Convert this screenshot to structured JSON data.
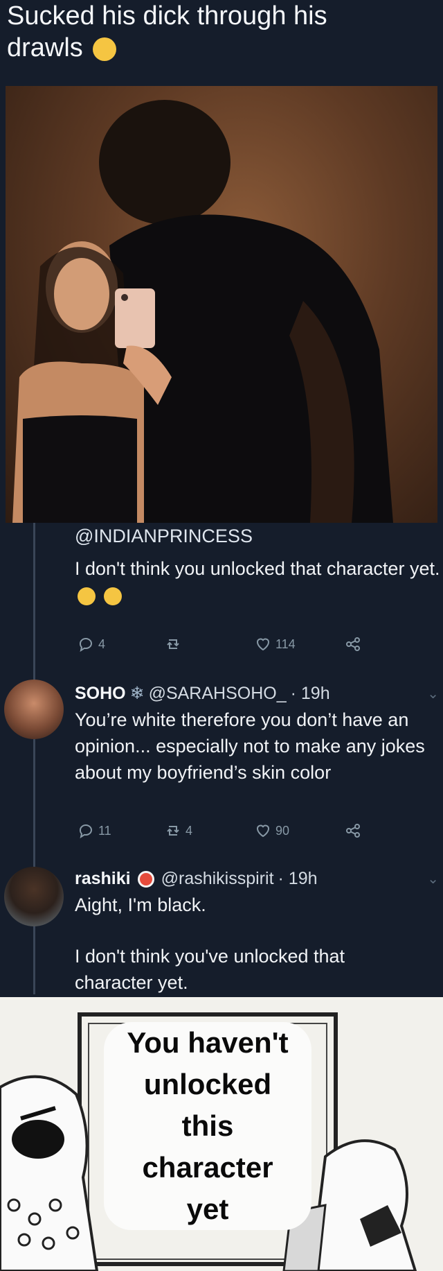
{
  "caption": "Sucked his dick through his drawls",
  "tweet1": {
    "handle": "@INDIANPRINCESS",
    "text": "I don't think you unlocked that character yet.",
    "replies": "4",
    "retweets": "",
    "likes": "114"
  },
  "tweet2": {
    "name": "SOHO",
    "handle": "@SARAHSOHO_",
    "time": "· 19h",
    "text": "You’re white therefore you don’t have an opinion... especially not to make any jokes about my boyfriend’s skin color",
    "replies": "11",
    "retweets": "4",
    "likes": "90"
  },
  "tweet3": {
    "name": "rashiki",
    "handle": "@rashikisspirit",
    "time": "· 19h",
    "line1": "Aight, I'm black.",
    "line2": "I don't think you've unlocked that character yet."
  },
  "meme": {
    "line1": "You haven't",
    "line2": "unlocked",
    "line3": "this",
    "line4": "character",
    "line5": "yet"
  },
  "icons": [
    "reply-icon",
    "retweet-icon",
    "like-icon",
    "share-icon",
    "chevron-down-icon",
    "snowflake-icon",
    "sushi-icon",
    "emoji-icon"
  ],
  "colors": {
    "background": "#151d2b",
    "muted": "#8899a6",
    "text": "#f1f3f6"
  }
}
